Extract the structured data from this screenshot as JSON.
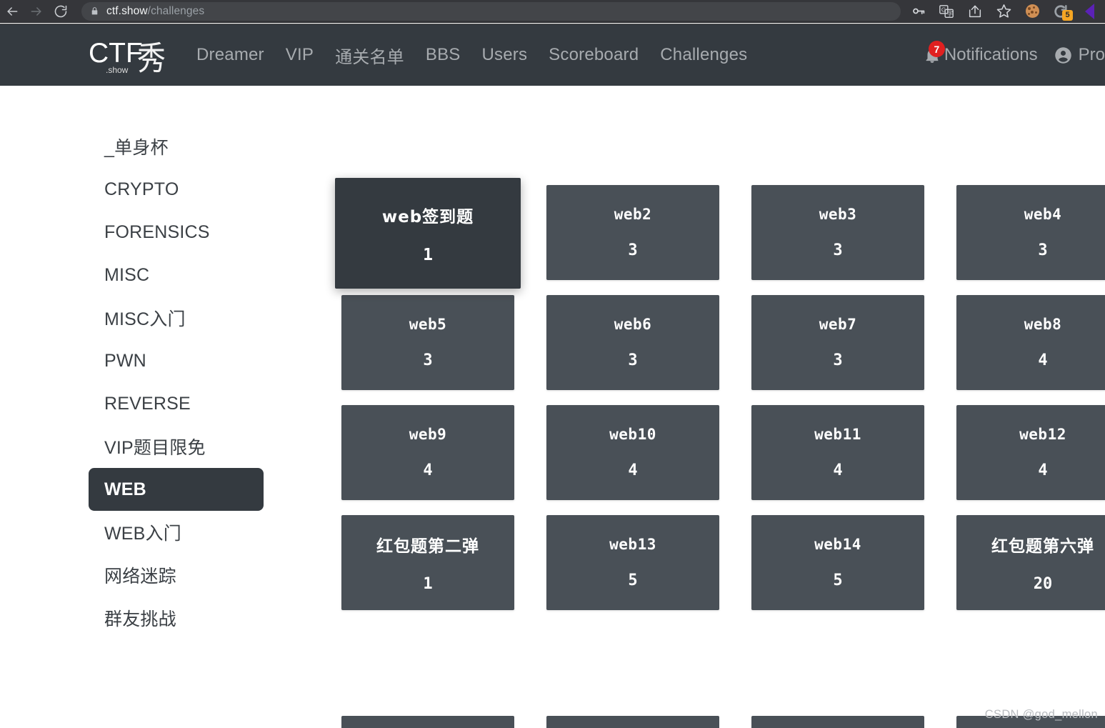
{
  "browser": {
    "back_icon": "back-arrow-icon",
    "forward_icon": "forward-arrow-icon",
    "reload_icon": "reload-icon",
    "lock_icon": "lock-icon",
    "url_host": "ctf.show",
    "url_path": "/challenges",
    "extensions": [
      {
        "name": "password-key-icon",
        "label": "key"
      },
      {
        "name": "translate-icon",
        "label": "G"
      },
      {
        "name": "share-icon",
        "label": "share"
      },
      {
        "name": "bookmark-star-icon",
        "label": "star"
      },
      {
        "name": "cookie-icon",
        "label": "cookie"
      },
      {
        "name": "clear-cache-icon",
        "label": "C",
        "badge": "5"
      },
      {
        "name": "purple-extension-icon",
        "label": ""
      }
    ]
  },
  "navbar": {
    "logo_main": "CTF",
    "logo_sub": ".show",
    "logo_cjk": "秀",
    "links": [
      {
        "label": "Dreamer"
      },
      {
        "label": "VIP"
      },
      {
        "label": "通关名单"
      },
      {
        "label": "BBS"
      },
      {
        "label": "Users"
      },
      {
        "label": "Scoreboard"
      },
      {
        "label": "Challenges"
      }
    ],
    "notifications_label": "Notifications",
    "notifications_count": "7",
    "profile_label": "Pro"
  },
  "sidebar": {
    "items": [
      {
        "label": "_单身杯",
        "active": false
      },
      {
        "label": "CRYPTO",
        "active": false
      },
      {
        "label": "FORENSICS",
        "active": false
      },
      {
        "label": "MISC",
        "active": false
      },
      {
        "label": "MISC入门",
        "active": false
      },
      {
        "label": "PWN",
        "active": false
      },
      {
        "label": "REVERSE",
        "active": false
      },
      {
        "label": "VIP题目限免",
        "active": false
      },
      {
        "label": "WEB",
        "active": true
      },
      {
        "label": "WEB入门",
        "active": false
      },
      {
        "label": "网络迷踪",
        "active": false
      },
      {
        "label": "群友挑战",
        "active": false
      }
    ]
  },
  "challenges": [
    {
      "title": "web签到题",
      "score": "1",
      "cjk": true,
      "hovered": true
    },
    {
      "title": "web2",
      "score": "3",
      "cjk": false,
      "hovered": false
    },
    {
      "title": "web3",
      "score": "3",
      "cjk": false,
      "hovered": false
    },
    {
      "title": "web4",
      "score": "3",
      "cjk": false,
      "hovered": false
    },
    {
      "title": "web5",
      "score": "3",
      "cjk": false,
      "hovered": false
    },
    {
      "title": "web6",
      "score": "3",
      "cjk": false,
      "hovered": false
    },
    {
      "title": "web7",
      "score": "3",
      "cjk": false,
      "hovered": false
    },
    {
      "title": "web8",
      "score": "4",
      "cjk": false,
      "hovered": false
    },
    {
      "title": "web9",
      "score": "4",
      "cjk": false,
      "hovered": false
    },
    {
      "title": "web10",
      "score": "4",
      "cjk": false,
      "hovered": false
    },
    {
      "title": "web11",
      "score": "4",
      "cjk": false,
      "hovered": false
    },
    {
      "title": "web12",
      "score": "4",
      "cjk": false,
      "hovered": false
    },
    {
      "title": "红包题第二弹",
      "score": "1",
      "cjk": true,
      "hovered": false
    },
    {
      "title": "web13",
      "score": "5",
      "cjk": false,
      "hovered": false
    },
    {
      "title": "web14",
      "score": "5",
      "cjk": false,
      "hovered": false
    },
    {
      "title": "红包题第六弹",
      "score": "20",
      "cjk": true,
      "hovered": false
    }
  ],
  "watermark": "CSDN @god_mellon",
  "colors": {
    "navbar_bg": "#343a40",
    "card_bg": "#495057",
    "card_hover_bg": "#343a40",
    "badge_red": "#e02020",
    "badge_orange": "#f5a623"
  }
}
